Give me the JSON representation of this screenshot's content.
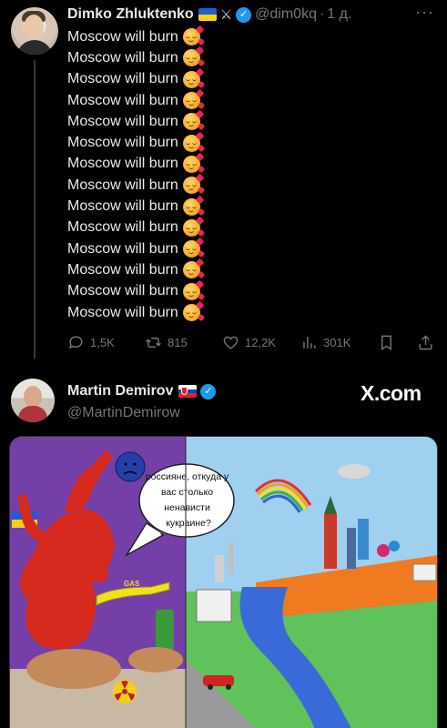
{
  "tweet1": {
    "author_name": "Dimko Zhluktenko",
    "handle": "@dim0kq",
    "time": "1 д.",
    "separator": "·",
    "more_icon": "more-icon",
    "lines": [
      "Moscow will burn",
      "Moscow will burn",
      "Moscow will burn",
      "Moscow will burn",
      "Moscow will burn",
      "Moscow will burn",
      "Moscow will burn",
      "Moscow will burn",
      "Moscow will burn",
      "Moscow will burn",
      "Moscow will burn",
      "Moscow will burn",
      "Moscow will burn",
      "Moscow will burn"
    ],
    "emoji": "smiling-face-with-hearts",
    "actions": {
      "replies": "1,5K",
      "retweets": "815",
      "likes": "12,2K",
      "views": "301K"
    }
  },
  "tweet2": {
    "author_name": "Martin Demirov",
    "handle": "@MartinDemirow",
    "brand": "X.com"
  },
  "media": {
    "speech_bubble": [
      "россияне, откуда у",
      "вас столько",
      "ненависти",
      "кукраине?"
    ],
    "gas_label": "GAS"
  },
  "colors": {
    "background": "#000000",
    "text": "#e7e9ea",
    "muted": "#71767b",
    "verified": "#1d9bf0",
    "divider": "#2f3336"
  }
}
